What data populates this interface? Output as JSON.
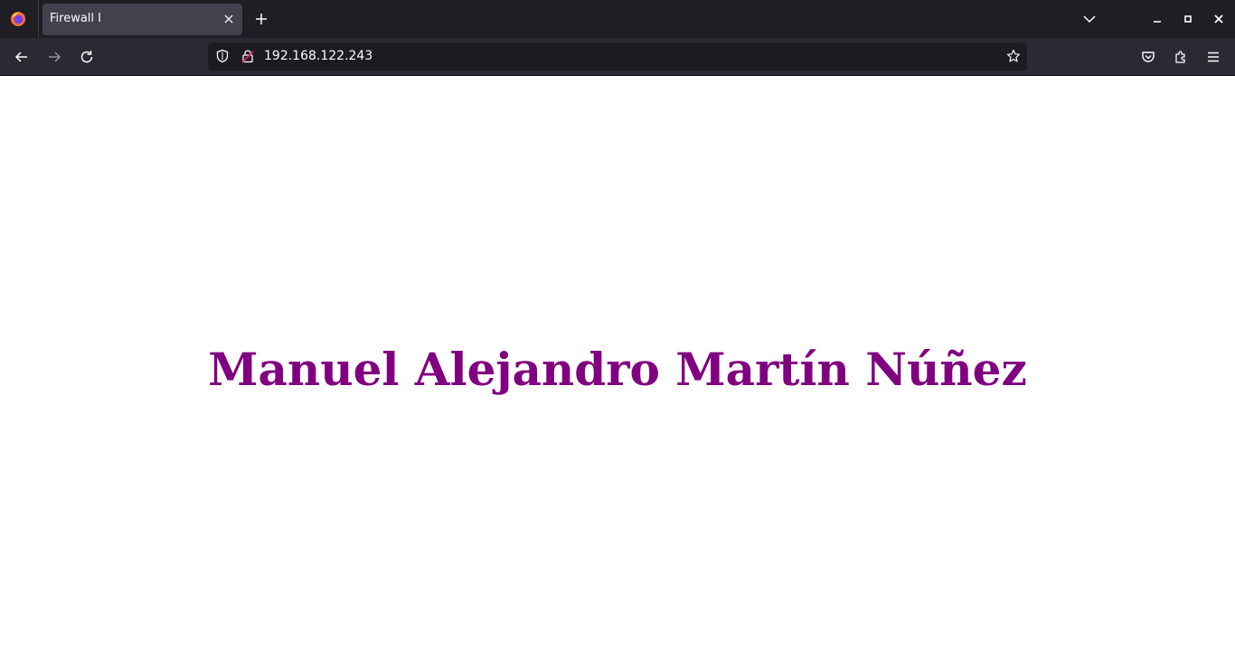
{
  "browser": {
    "tab": {
      "title": "Firewall I"
    },
    "url": "192.168.122.243"
  },
  "page": {
    "heading": "Manuel Alejandro Martín Núñez",
    "heading_color": "#800080"
  },
  "colors": {
    "tabstrip_bg": "#1f1e25",
    "active_tab_bg": "#42414d",
    "navbar_bg": "#2b2a33",
    "urlbar_bg": "#1c1b22",
    "icon_color": "#fbfbfe"
  },
  "icons": [
    "firefox-logo-icon",
    "close-icon",
    "plus-icon",
    "chevron-down-icon",
    "minimize-icon",
    "maximize-icon",
    "close-window-icon",
    "back-arrow-icon",
    "forward-arrow-icon",
    "reload-icon",
    "shield-icon",
    "insecure-lock-icon",
    "star-icon",
    "pocket-icon",
    "extensions-icon",
    "hamburger-menu-icon"
  ]
}
